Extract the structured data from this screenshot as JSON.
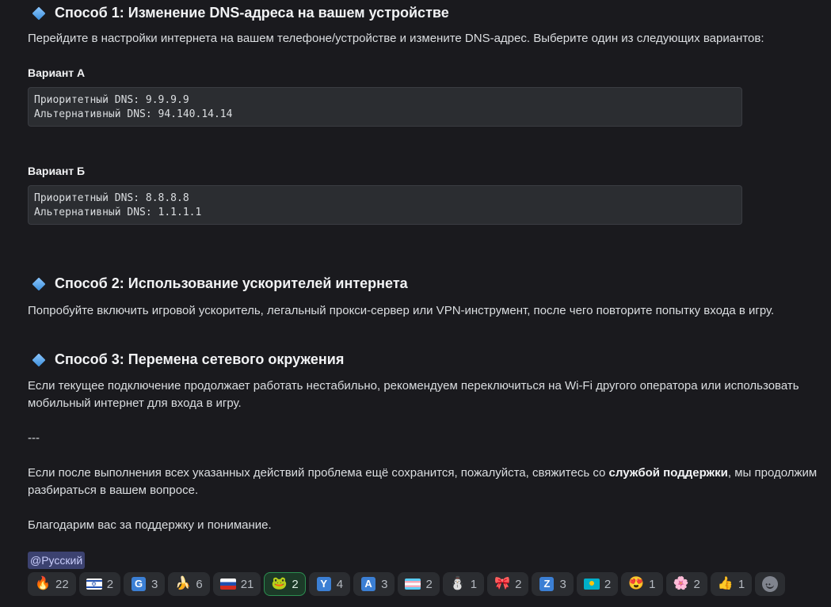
{
  "method1": {
    "title": "Способ 1: Изменение DNS-адреса на вашем устройстве",
    "text": "Перейдите в настройки интернета на вашем телефоне/устройстве и измените DNS-адрес. Выберите один из следующих вариантов:",
    "variant_a": {
      "label": "Вариант А",
      "line1": "Приоритетный DNS: 9.9.9.9",
      "line2": "Альтернативный DNS: 94.140.14.14"
    },
    "variant_b": {
      "label": "Вариант Б",
      "line1": "Приоритетный DNS: 8.8.8.8",
      "line2": "Альтернативный DNS: 1.1.1.1"
    }
  },
  "method2": {
    "title": "Способ 2: Использование ускорителей интернета",
    "text": "Попробуйте включить игровой ускоритель, легальный прокси-сервер или VPN-инструмент, после чего повторите попытку входа в игру."
  },
  "method3": {
    "title": "Способ 3: Перемена сетевого окружения",
    "text_line1": "Если текущее подключение продолжает работать нестабильно, рекомендуем переключиться на Wi-Fi другого оператора или использовать",
    "text_line2": "мобильный интернет для входа в игру."
  },
  "separator": "---",
  "support": {
    "before": "Если после выполнения всех указанных действий проблема ещё сохранится, пожалуйста, свяжитесь со ",
    "bold": "службой поддержки",
    "after": ", мы продолжим",
    "line2": "разбираться в вашем вопросе."
  },
  "thanks": "Благодарим вас за поддержку и понимание.",
  "mention": "@Русский",
  "reactions": [
    {
      "icon": "fire-emoji",
      "count": "22"
    },
    {
      "icon": "israel-flag",
      "count": "2"
    },
    {
      "icon": "letter-g-emoji",
      "letter": "G",
      "count": "3"
    },
    {
      "icon": "banana-emoji",
      "count": "6"
    },
    {
      "icon": "russia-flag",
      "count": "21"
    },
    {
      "icon": "custom-frog-emoji",
      "count": "2",
      "active": true
    },
    {
      "icon": "letter-y-emoji",
      "letter": "Y",
      "count": "4"
    },
    {
      "icon": "letter-a-emoji",
      "letter": "A",
      "count": "3"
    },
    {
      "icon": "transgender-flag",
      "count": "2"
    },
    {
      "icon": "snowman-emoji",
      "count": "1"
    },
    {
      "icon": "custom-anime-emoji",
      "count": "2"
    },
    {
      "icon": "letter-z-emoji",
      "letter": "Z",
      "count": "3"
    },
    {
      "icon": "kazakhstan-flag",
      "count": "2"
    },
    {
      "icon": "heart-eyes-emoji",
      "count": "1"
    },
    {
      "icon": "custom-anime-girl-emoji",
      "count": "2"
    },
    {
      "icon": "thumbs-up-emoji",
      "count": "1"
    }
  ]
}
